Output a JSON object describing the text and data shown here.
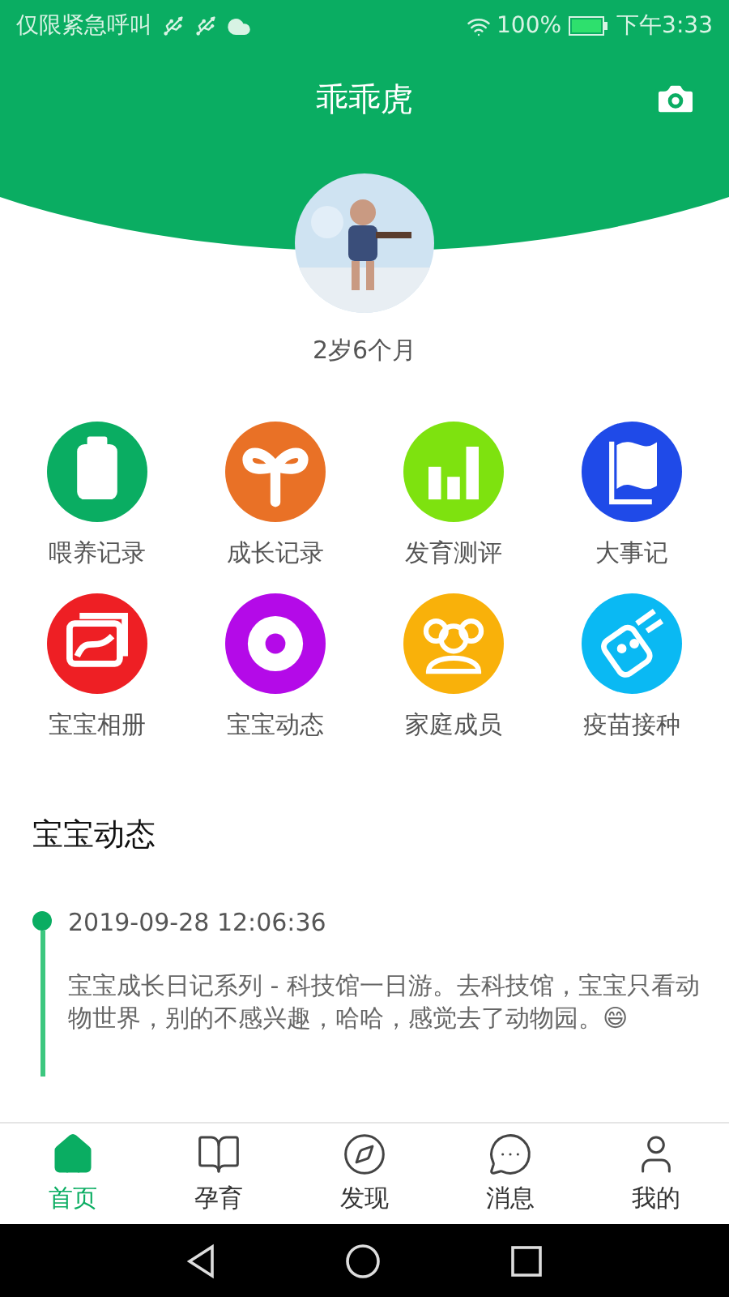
{
  "status_bar": {
    "carrier": "仅限紧急呼叫",
    "battery": "100%",
    "time": "下午3:33"
  },
  "header": {
    "title": "乖乖虎"
  },
  "profile": {
    "age": "2岁6个月"
  },
  "features": [
    {
      "label": "喂养记录",
      "color": "#0aad62"
    },
    {
      "label": "成长记录",
      "color": "#e97126"
    },
    {
      "label": "发育测评",
      "color": "#7ee20f"
    },
    {
      "label": "大事记",
      "color": "#1f4ae8"
    },
    {
      "label": "宝宝相册",
      "color": "#ee1f24"
    },
    {
      "label": "宝宝动态",
      "color": "#b40ae8"
    },
    {
      "label": "家庭成员",
      "color": "#f9b10a"
    },
    {
      "label": "疫苗接种",
      "color": "#0ab9f3"
    }
  ],
  "section": {
    "title": "宝宝动态"
  },
  "feed": [
    {
      "time": "2019-09-28 12:06:36",
      "text": "宝宝成长日记系列 - 科技馆一日游。去科技馆，宝宝只看动物世界，别的不感兴趣，哈哈，感觉去了动物园。😄"
    }
  ],
  "tabs": [
    {
      "label": "首页",
      "selected": true
    },
    {
      "label": "孕育",
      "selected": false
    },
    {
      "label": "发现",
      "selected": false
    },
    {
      "label": "消息",
      "selected": false
    },
    {
      "label": "我的",
      "selected": false
    }
  ]
}
